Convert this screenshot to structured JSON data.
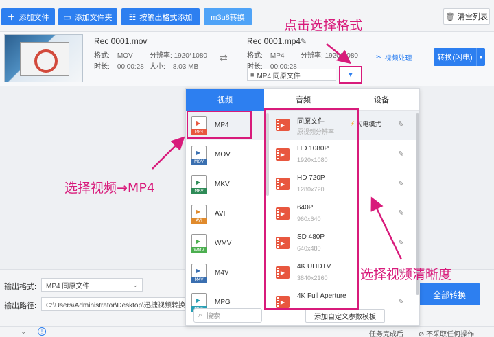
{
  "toolbar": {
    "add_file": "添加文件",
    "add_folder": "添加文件夹",
    "add_by_format": "按输出格式添加",
    "m3u8": "m3u8转换",
    "clear": "清空列表"
  },
  "file": {
    "source_name": "Rec 0001.mov",
    "source_format_label": "格式:",
    "source_format": "MOV",
    "source_resolution_label": "分辨率:",
    "source_resolution": "1920*1080",
    "source_duration_label": "时长:",
    "source_duration": "00:00:28",
    "source_size_label": "大小:",
    "source_size": "8.03 MB",
    "target_name": "Rec 0001.mp4",
    "target_format_label": "格式:",
    "target_format": "MP4",
    "target_resolution_label": "分辨率:",
    "target_resolution": "1920*1080",
    "target_duration_label": "时长:",
    "target_duration": "00:00:28",
    "format_select": "MP4  同原文件",
    "video_process": "视频处理",
    "convert": "转换(闪电)"
  },
  "annotations": {
    "click_format": "点击选择格式",
    "choose_mp4": "选择视频→MP4",
    "choose_resolution": "选择视频清晰度"
  },
  "panel": {
    "tabs": [
      "视频",
      "音频",
      "设备"
    ],
    "formats": [
      {
        "label": "MP4",
        "band": "MP4",
        "color": "#e8573f"
      },
      {
        "label": "MOV",
        "band": "MOV",
        "color": "#3a6fb0"
      },
      {
        "label": "MKV",
        "band": "MKV",
        "color": "#2e8b57"
      },
      {
        "label": "AVI",
        "band": "AVI",
        "color": "#e08a2c"
      },
      {
        "label": "WMV",
        "band": "WMV",
        "color": "#4caf50"
      },
      {
        "label": "M4V",
        "band": "M4V",
        "color": "#3a6fb0"
      },
      {
        "label": "MPG",
        "band": "MPG",
        "color": "#2aa0b5"
      }
    ],
    "resolutions": [
      {
        "name": "同原文件",
        "sub": "原视频分辨率",
        "flash": "闪电模式"
      },
      {
        "name": "HD 1080P",
        "sub": "1920x1080"
      },
      {
        "name": "HD 720P",
        "sub": "1280x720"
      },
      {
        "name": "640P",
        "sub": "960x640"
      },
      {
        "name": "SD 480P",
        "sub": "640x480"
      },
      {
        "name": "4K UHDTV",
        "sub": "3840x2160"
      },
      {
        "name": "4K Full Aperture",
        "sub": ""
      }
    ],
    "search_placeholder": "搜索",
    "custom_template": "添加自定义参数模板"
  },
  "bottom": {
    "output_format_label": "输出格式:",
    "output_format": "MP4  同原文件",
    "output_path_label": "输出路径:",
    "output_path": "C:\\Users\\Administrator\\Desktop\\迅捷视频转换",
    "convert_all": "全部转换",
    "after_done": "任务完成后",
    "no_action": "不采取任何操作"
  }
}
